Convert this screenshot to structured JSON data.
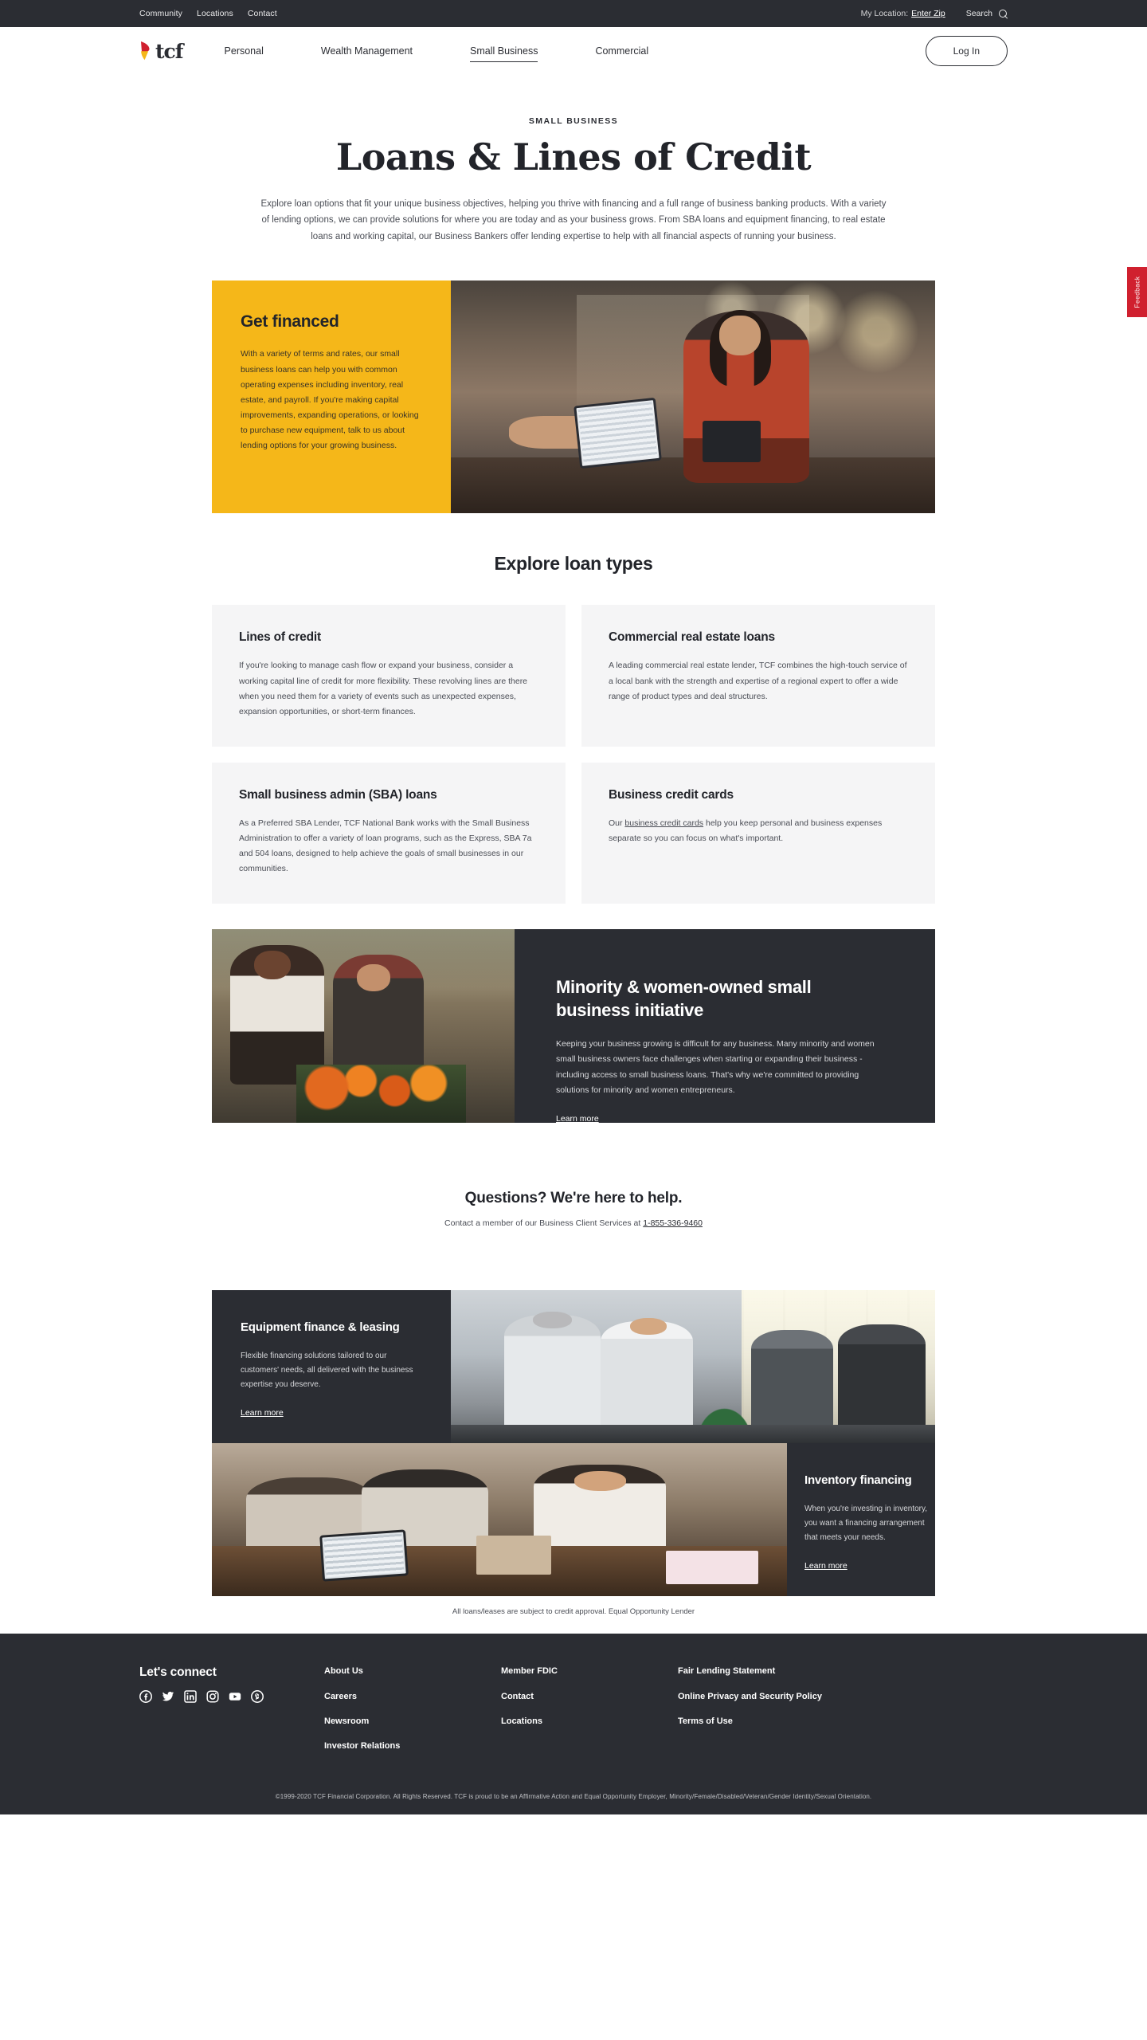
{
  "utility": {
    "links": [
      {
        "label": "Community"
      },
      {
        "label": "Locations"
      },
      {
        "label": "Contact"
      }
    ],
    "location_label": "My Location:",
    "location_value": "Enter Zip",
    "search_label": "Search",
    "search_icon": "search-icon"
  },
  "nav": {
    "logo_text": "tcf",
    "logo_icon": "tcf-flame-logo",
    "items": [
      {
        "label": "Personal",
        "active": false
      },
      {
        "label": "Wealth Management",
        "active": false
      },
      {
        "label": "Small Business",
        "active": true
      },
      {
        "label": "Commercial",
        "active": false
      }
    ],
    "login_label": "Log In"
  },
  "feedback": {
    "label": "Feedback",
    "color": "#d0202f"
  },
  "hero": {
    "eyebrow": "SMALL BUSINESS",
    "title": "Loans & Lines of Credit",
    "paragraph": "Explore loan options that fit your unique business objectives, helping you thrive with financing and a full range of business banking products. With a variety of lending options, we can provide solutions for where you are today and as your business grows. From SBA loans and equipment financing, to real estate loans and working capital, our Business Bankers offer lending expertise to help with all financial aspects of running your business."
  },
  "get_financed": {
    "title": "Get financed",
    "paragraph": "With a variety of terms and rates, our small business loans can help you with common operating expenses including inventory, real estate, and payroll. If you're making capital improvements, expanding operations, or looking to purchase new equipment, talk to us about lending options for your growing business.",
    "bg_color": "#F5B719",
    "image_alt": "woman-at-cafe-counter-with-tablet-photo"
  },
  "explore": {
    "title": "Explore loan types",
    "cards": [
      {
        "title": "Lines of credit",
        "body": "If you're looking to manage cash flow or expand your business, consider a working capital line of credit for more flexibility. These revolving lines are there when you need them for a variety of events such as unexpected expenses, expansion opportunities, or short-term finances."
      },
      {
        "title": "Commercial real estate loans",
        "body": "A leading commercial real estate lender, TCF combines the high-touch service of a local bank with the strength and expertise of a regional expert to offer a wide range of product types and deal structures."
      },
      {
        "title": "Small business admin (SBA) loans",
        "body": "As a Preferred SBA Lender, TCF National Bank works with the Small Business Administration to offer a variety of loan programs, such as the Express, SBA 7a and 504 loans, designed to help achieve the goals of small businesses in our communities."
      },
      {
        "title": "Business credit cards",
        "body_before": "Our ",
        "body_link": "business credit cards",
        "body_after": " help you keep personal and business expenses separate so you can focus on what's important."
      }
    ]
  },
  "minority": {
    "title": "Minority & women-owned small business initiative",
    "paragraph": "Keeping your business growing is difficult for any business. Many minority and women small business owners face challenges when starting or expanding their business - including access to small business loans. That's why we're committed to providing solutions for minority and women entrepreneurs.",
    "link_label": "Learn more",
    "image_alt": "two-women-florists-photo"
  },
  "questions": {
    "title": "Questions? We're here to help.",
    "text_before": "Contact a member of our Business Client Services at ",
    "phone": "1-855-336-9460"
  },
  "equipment": {
    "title": "Equipment finance & leasing",
    "paragraph": "Flexible financing solutions tailored to our customers' needs, all delivered with the business expertise you deserve.",
    "link_label": "Learn more",
    "image_alt": "business-handshake-meeting-photo"
  },
  "inventory": {
    "title": "Inventory financing",
    "paragraph": "When you're investing in inventory, you want a financing arrangement that meets your needs.",
    "link_label": "Learn more",
    "image_alt": "retail-checkout-counter-photo"
  },
  "disclaimer": "All loans/leases are subject to credit approval. Equal Opportunity Lender",
  "footer": {
    "connect_title": "Let's connect",
    "socials": [
      {
        "name": "facebook-icon"
      },
      {
        "name": "twitter-icon"
      },
      {
        "name": "linkedin-icon"
      },
      {
        "name": "instagram-icon"
      },
      {
        "name": "youtube-icon"
      },
      {
        "name": "pinterest-icon"
      }
    ],
    "columns": [
      {
        "links": [
          {
            "label": "About Us"
          },
          {
            "label": "Careers"
          },
          {
            "label": "Newsroom"
          },
          {
            "label": "Investor Relations"
          }
        ]
      },
      {
        "links": [
          {
            "label": "Member FDIC"
          },
          {
            "label": "Contact"
          },
          {
            "label": "Locations"
          }
        ]
      },
      {
        "links": [
          {
            "label": "Fair Lending Statement"
          },
          {
            "label": "Online Privacy and Security Policy"
          },
          {
            "label": "Terms of Use"
          }
        ]
      }
    ],
    "copyright": "©1999-2020 TCF Financial Corporation. All Rights Reserved. TCF is proud to be an Affirmative Action and Equal Opportunity Employer, Minority/Female/Disabled/Veteran/Gender Identity/Sexual Orientation."
  }
}
